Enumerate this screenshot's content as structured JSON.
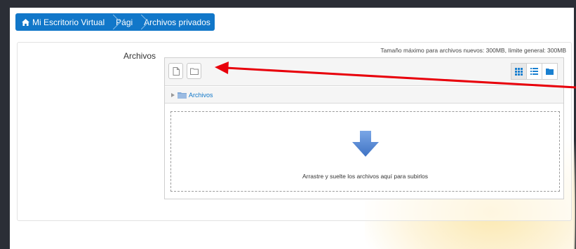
{
  "breadcrumb": {
    "items": [
      {
        "label": "Mi Escritorio Virtual",
        "icon": "home-icon"
      },
      {
        "label": "Pági"
      },
      {
        "label": "Archivos privados"
      }
    ]
  },
  "form": {
    "field_label": "Archivos",
    "max_size_text": "Tamaño máximo para archivos nuevos: 300MB, límite general: 300MB"
  },
  "filemanager": {
    "toolbar": {
      "add_file_icon": "file-icon",
      "create_folder_icon": "folder-icon",
      "views": [
        {
          "icon": "grid-icon",
          "active": true
        },
        {
          "icon": "list-icon",
          "active": false
        },
        {
          "icon": "tree-folder-icon",
          "active": false
        }
      ]
    },
    "path": {
      "folder_label": "Archivos"
    },
    "dropzone": {
      "text": "Arrastre y suelte los archivos aquí para subirlos",
      "icon": "arrow-down-icon"
    }
  },
  "annotation": {
    "type": "red-arrow",
    "color": "#e8000b"
  },
  "colors": {
    "brand": "#1177c9",
    "frame": "#2b2e36",
    "drop_arrow": "#5b8dd6"
  }
}
